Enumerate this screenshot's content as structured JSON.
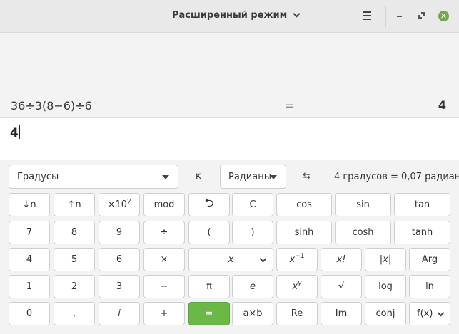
{
  "titlebar": {
    "title": "Расширенный режим"
  },
  "history": {
    "expression": "36÷3(8−6)÷6",
    "equals": "=",
    "result": "4"
  },
  "entry": {
    "value": "4"
  },
  "conversion": {
    "from_unit": "Градусы",
    "in_label": "к",
    "to_unit": "Радианы",
    "swap_glyph": "⇆",
    "result": "4 градусов  =  0,07 радиан"
  },
  "keys": {
    "shift_down": "↓n",
    "shift_up": "↑n",
    "sci_base": "×10",
    "sci_exp": "y",
    "mod": "mod",
    "undo": "⮌",
    "clear": "C",
    "cos": "cos",
    "sin": "sin",
    "tan": "tan",
    "d7": "7",
    "d8": "8",
    "d9": "9",
    "divide": "÷",
    "lparen": "(",
    "rparen": ")",
    "sinh": "sinh",
    "cosh": "cosh",
    "tanh": "tanh",
    "d4": "4",
    "d5": "5",
    "d6": "6",
    "multiply": "×",
    "variable": "x",
    "inverse_base": "x",
    "inverse_exp": "−1",
    "factorial": "x!",
    "abs": "|x|",
    "arg": "Arg",
    "d1": "1",
    "d2": "2",
    "d3": "3",
    "minus": "−",
    "pi": "π",
    "e": "e",
    "power_base": "x",
    "power_exp": "y",
    "sqrt": "√",
    "log": "log",
    "ln": "ln",
    "d0": "0",
    "comma": ",",
    "imag": "i",
    "plus": "+",
    "equals": "=",
    "subscript": "a×b",
    "re": "Re",
    "im": "Im",
    "conj": "conj",
    "fx": "f(x)"
  },
  "colors": {
    "equals_button": "#6ab845",
    "close_button": "#6dab4a"
  }
}
